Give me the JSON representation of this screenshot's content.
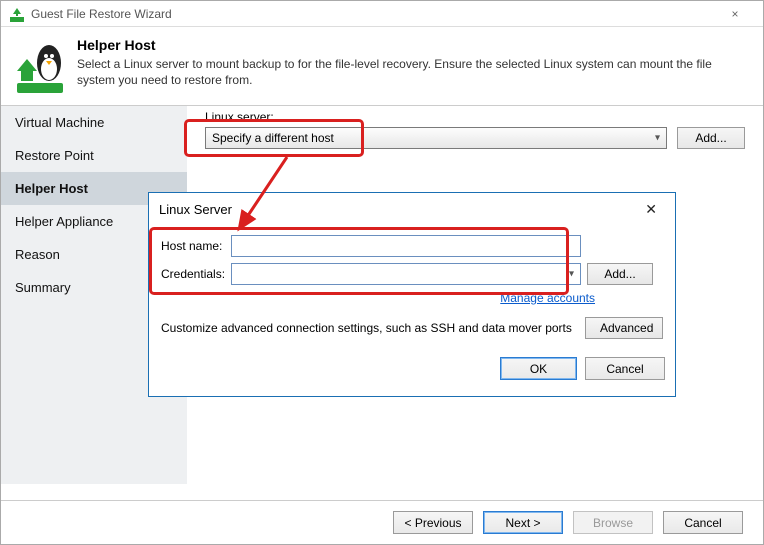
{
  "window": {
    "title": "Guest File Restore Wizard",
    "close_label": "×"
  },
  "header": {
    "title": "Helper Host",
    "desc": "Select a Linux server to mount backup to for the file-level recovery. Ensure the selected Linux system can mount the file system you need to restore from."
  },
  "nav": [
    "Virtual Machine",
    "Restore Point",
    "Helper Host",
    "Helper Appliance",
    "Reason",
    "Summary"
  ],
  "linux_server_label": "Linux server:",
  "linux_server_value": "Specify a different host",
  "add_button": "Add...",
  "dialog": {
    "title": "Linux Server",
    "close": "✕",
    "host_label": "Host name:",
    "host_value": "",
    "cred_label": "Credentials:",
    "cred_value": "",
    "cred_add": "Add...",
    "manage_link": "Manage accounts",
    "note": "Customize advanced connection settings, such as SSH and data mover ports",
    "advanced": "Advanced",
    "ok": "OK",
    "cancel": "Cancel"
  },
  "footer": {
    "prev": "< Previous",
    "next": "Next >",
    "browse": "Browse",
    "cancel": "Cancel"
  }
}
